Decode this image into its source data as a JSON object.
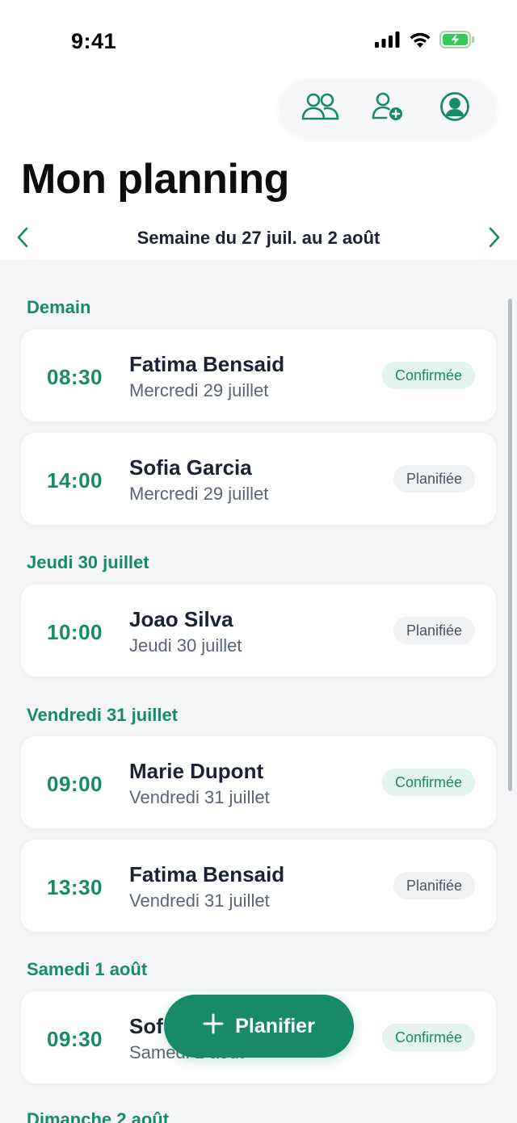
{
  "status_bar": {
    "time": "9:41",
    "icons": [
      "signal-icon",
      "wifi-icon",
      "battery-charging-icon"
    ]
  },
  "top_actions": {
    "icons": [
      "group-icon",
      "add-person-icon",
      "account-icon"
    ]
  },
  "header": {
    "title": "Mon planning"
  },
  "week_nav": {
    "label": "Semaine du 27 juil. au 2 août",
    "prev_icon": "chevron-left-icon",
    "next_icon": "chevron-right-icon"
  },
  "sections": [
    {
      "title": "Demain",
      "appointments": [
        {
          "time": "08:30",
          "name": "Fatima Bensaid",
          "date": "Mercredi 29 juillet",
          "status": "Confirmée",
          "status_type": "confirmed"
        },
        {
          "time": "14:00",
          "name": "Sofia Garcia",
          "date": "Mercredi 29 juillet",
          "status": "Planifiée",
          "status_type": "planned"
        }
      ]
    },
    {
      "title": "Jeudi 30 juillet",
      "appointments": [
        {
          "time": "10:00",
          "name": "Joao Silva",
          "date": "Jeudi 30 juillet",
          "status": "Planifiée",
          "status_type": "planned"
        }
      ]
    },
    {
      "title": "Vendredi 31 juillet",
      "appointments": [
        {
          "time": "09:00",
          "name": "Marie Dupont",
          "date": "Vendredi 31 juillet",
          "status": "Confirmée",
          "status_type": "confirmed"
        },
        {
          "time": "13:30",
          "name": "Fatima Bensaid",
          "date": "Vendredi 31 juillet",
          "status": "Planifiée",
          "status_type": "planned"
        }
      ]
    },
    {
      "title": "Samedi 1 août",
      "appointments": [
        {
          "time": "09:30",
          "name": "Sof",
          "date": "Samedi 1 août",
          "status": "Confirmée",
          "status_type": "confirmed"
        }
      ]
    },
    {
      "title": "Dimanche 2 août",
      "appointments": []
    }
  ],
  "fab": {
    "label": "Planifier",
    "icon": "plus-icon"
  },
  "colors": {
    "accent": "#178a6a",
    "confirmed_bg": "#e3f4ec",
    "planned_bg": "#f1f2f4",
    "list_bg": "#f4f5f7"
  }
}
